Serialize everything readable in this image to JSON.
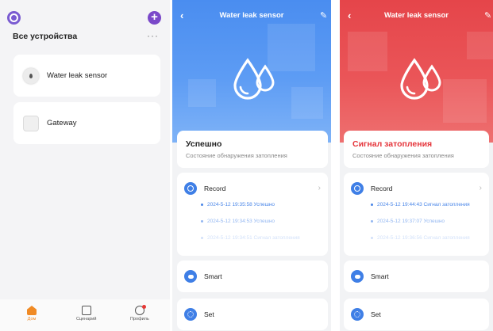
{
  "list_panel": {
    "title": "Все устройства",
    "more_glyph": "···",
    "add_glyph": "+",
    "devices": [
      {
        "label": "Water leak sensor",
        "icon": "water-drop-icon"
      },
      {
        "label": "Gateway",
        "icon": "gateway-icon"
      }
    ],
    "tabs": [
      {
        "label": "Дом",
        "icon": "home-icon",
        "active": true
      },
      {
        "label": "Сценарий",
        "icon": "scene-icon",
        "active": false
      },
      {
        "label": "Профиль",
        "icon": "profile-icon",
        "active": false
      }
    ]
  },
  "sensor_normal": {
    "header_title": "Water leak sensor",
    "back_glyph": "‹",
    "edit_glyph": "✎",
    "theme_color": "#4a8df0",
    "status_main": "Успешно",
    "status_sub": "Состояние обнаружения затопления",
    "record_label": "Record",
    "records": [
      "2024-5-12 19:35:58 Успешно",
      "2024-5-12 19:34:53 Успешно",
      "2024-5-12 19:34:51 Сигнал затопления"
    ],
    "smart_label": "Smart",
    "set_label": "Set"
  },
  "sensor_alarm": {
    "header_title": "Water leak sensor",
    "back_glyph": "‹",
    "edit_glyph": "✎",
    "theme_color": "#e5454a",
    "status_main": "Сигнал затопления",
    "status_sub": "Состояние обнаружения затопления",
    "record_label": "Record",
    "records": [
      "2024-5-12 19:44:43 Сигнал затопления",
      "2024-5-12 19:37:07 Успешно",
      "2024-5-12 19:36:56 Сигнал затопления"
    ],
    "smart_label": "Smart",
    "set_label": "Set"
  },
  "colors": {
    "accent_blue": "#4a86e8",
    "alarm_red": "#e5353b",
    "home_tab_orange": "#f08a24",
    "brand_purple": "#7a48c9"
  }
}
